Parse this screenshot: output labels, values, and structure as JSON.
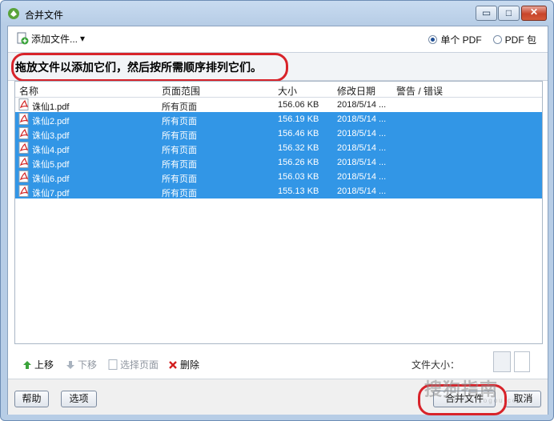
{
  "window": {
    "title": "合并文件",
    "min_glyph": "▭",
    "max_glyph": "□",
    "close_glyph": "✕"
  },
  "toolbar": {
    "add_files_label": "添加文件...",
    "add_files_arrow": "▾",
    "output_options": [
      {
        "label": "单个 PDF",
        "selected": true
      },
      {
        "label": "PDF 包",
        "selected": false
      }
    ]
  },
  "instruction": "拖放文件以添加它们，然后按所需顺序排列它们。",
  "file_list": {
    "columns": [
      "名称",
      "页面范围",
      "大小",
      "修改日期",
      "警告 / 错误"
    ],
    "rows": [
      {
        "name": "诛仙1.pdf",
        "range": "所有页面",
        "size": "156.06 KB",
        "date": "2018/5/14 ...",
        "warn": "",
        "selected": false
      },
      {
        "name": "诛仙2.pdf",
        "range": "所有页面",
        "size": "156.19 KB",
        "date": "2018/5/14 ...",
        "warn": "",
        "selected": true
      },
      {
        "name": "诛仙3.pdf",
        "range": "所有页面",
        "size": "156.46 KB",
        "date": "2018/5/14 ...",
        "warn": "",
        "selected": true
      },
      {
        "name": "诛仙4.pdf",
        "range": "所有页面",
        "size": "156.32 KB",
        "date": "2018/5/14 ...",
        "warn": "",
        "selected": true
      },
      {
        "name": "诛仙5.pdf",
        "range": "所有页面",
        "size": "156.26 KB",
        "date": "2018/5/14 ...",
        "warn": "",
        "selected": true
      },
      {
        "name": "诛仙6.pdf",
        "range": "所有页面",
        "size": "156.03 KB",
        "date": "2018/5/14 ...",
        "warn": "",
        "selected": true
      },
      {
        "name": "诛仙7.pdf",
        "range": "所有页面",
        "size": "155.13 KB",
        "date": "2018/5/14 ...",
        "warn": "",
        "selected": true
      }
    ]
  },
  "bottom_toolbar": {
    "move_up": "上移",
    "move_down": "下移",
    "select_pages": "选择页面",
    "delete": "删除",
    "file_size_label": "文件大小："
  },
  "footer": {
    "help": "帮助",
    "options": "选项",
    "merge": "合并文件",
    "cancel": "取消"
  },
  "watermark": {
    "text": "搜狗指南",
    "sub": "zhinan.sogou.com"
  },
  "colors": {
    "selection": "#3296e6",
    "highlight_ring": "#d8232a",
    "pdf_red": "#d21f1f"
  }
}
